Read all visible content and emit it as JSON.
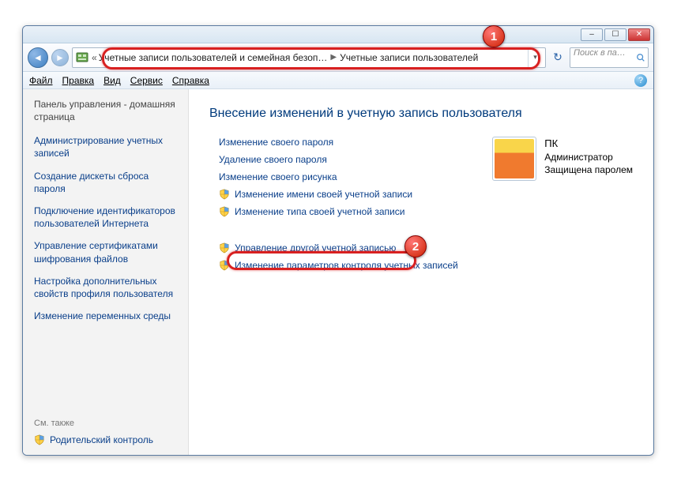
{
  "titlebar": {
    "min_glyph": "–",
    "max_glyph": "☐",
    "close_glyph": "✕"
  },
  "nav": {
    "overflow": "«",
    "crumb1": "Учетные записи пользователей и семейная безоп…",
    "crumb2": "Учетные записи пользователей",
    "sep": "▶",
    "drop": "▾"
  },
  "search": {
    "placeholder": "Поиск в па…"
  },
  "menu": {
    "file": "Файл",
    "edit": "Правка",
    "view": "Вид",
    "tools": "Сервис",
    "help": "Справка",
    "help_glyph": "?"
  },
  "sidebar": {
    "head": "Панель управления - домашняя страница",
    "links": [
      "Администрирование учетных записей",
      "Создание дискеты сброса пароля",
      "Подключение идентификаторов пользователей Интернета",
      "Управление сертификатами шифрования файлов",
      "Настройка дополнительных свойств профиля пользователя",
      "Изменение переменных среды"
    ],
    "also": "См. также",
    "parental": "Родительский контроль"
  },
  "main": {
    "heading": "Внесение изменений в учетную запись пользователя",
    "links": {
      "change_pw": "Изменение своего пароля",
      "remove_pw": "Удаление своего пароля",
      "change_pic": "Изменение своего рисунка",
      "change_name": "Изменение имени своей учетной записи",
      "change_type": "Изменение типа своей учетной записи",
      "manage_other": "Управление другой учетной записью",
      "uac": "Изменение параметров контроля учетных записей"
    }
  },
  "user": {
    "name": "ПК",
    "role": "Администратор",
    "protected": "Защищена паролем"
  },
  "annot": {
    "n1": "1",
    "n2": "2"
  }
}
